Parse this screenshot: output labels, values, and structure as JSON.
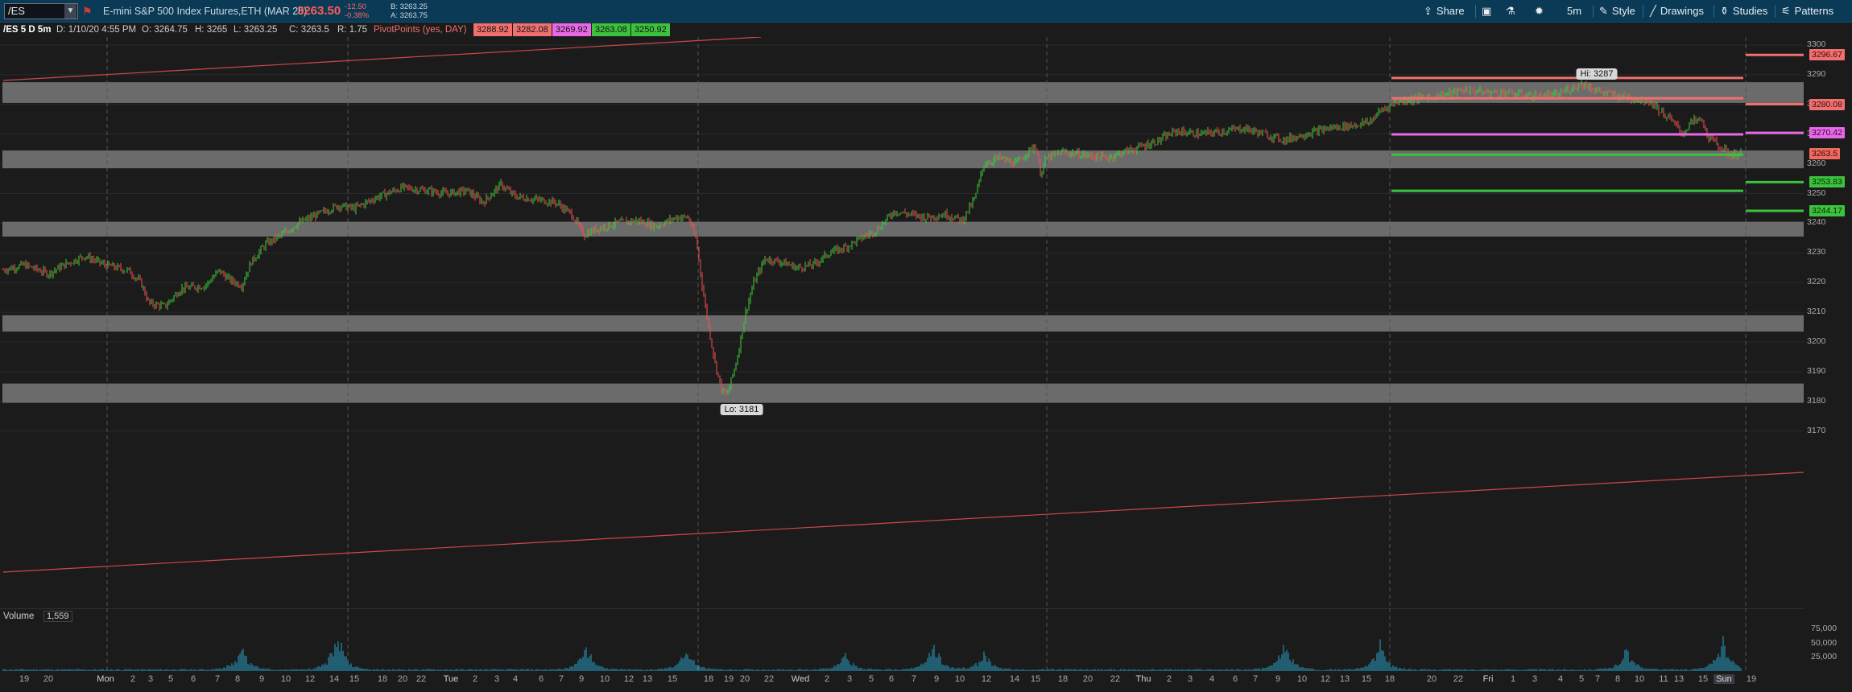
{
  "toolbar": {
    "symbol": "/ES",
    "description": "E-mini S&P 500 Index Futures,ETH (MAR 20)",
    "last_price": "3263.50",
    "change": "-12.50",
    "change_pct": "-0.38%",
    "bid": "B: 3263.25",
    "ask": "A: 3263.75",
    "share_label": "Share",
    "interval_label": "5m",
    "style_label": "Style",
    "drawings_label": "Drawings",
    "studies_label": "Studies",
    "patterns_label": "Patterns"
  },
  "info": {
    "chart_id": "/ES 5 D 5m",
    "date": "D: 1/10/20 4:55 PM",
    "open": "O: 3264.75",
    "high": "H: 3265",
    "low": "L: 3263.25",
    "close": "C: 3263.5",
    "range": "R: 1.75",
    "study": "PivotPoints (yes, DAY)",
    "r2": "3288.92",
    "r1": "3282.08",
    "pp": "3269.92",
    "s1": "3263.08",
    "s2": "3250.92"
  },
  "axis": {
    "price_ticks": [
      "3300",
      "3290",
      "3280",
      "3270",
      "3260",
      "3250",
      "3240",
      "3230",
      "3220",
      "3210",
      "3200",
      "3190",
      "3180",
      "3170"
    ],
    "price_tags": [
      {
        "label": "3296.67",
        "color": "#f07070",
        "text_color": "#3a0b0b"
      },
      {
        "label": "3280.08",
        "color": "#f07070",
        "text_color": "#3a0b0b"
      },
      {
        "label": "3270.42",
        "color": "#e868e8",
        "text_color": "#300830"
      },
      {
        "label": "3263.5",
        "color": "#f06a60",
        "text_color": "#300808"
      },
      {
        "label": "3253.83",
        "color": "#3cc23c",
        "text_color": "#062606"
      },
      {
        "label": "3244.17",
        "color": "#3cc23c",
        "text_color": "#062606"
      }
    ],
    "volume_ticks": [
      "75,000",
      "50,000",
      "25,000"
    ],
    "time_labels": [
      "19",
      "20",
      "Mon",
      "2",
      "3",
      "5",
      "6",
      "7",
      "8",
      "9",
      "10",
      "12",
      "14",
      "15",
      "18",
      "20",
      "22",
      "Tue",
      "2",
      "3",
      "4",
      "6",
      "7",
      "9",
      "10",
      "12",
      "13",
      "15",
      "18",
      "19",
      "20",
      "22",
      "Wed",
      "2",
      "3",
      "5",
      "6",
      "7",
      "9",
      "10",
      "12",
      "14",
      "15",
      "18",
      "20",
      "22",
      "Thu",
      "2",
      "3",
      "4",
      "6",
      "7",
      "9",
      "10",
      "12",
      "13",
      "15",
      "18",
      "20",
      "22",
      "Fri",
      "1",
      "3",
      "4",
      "5",
      "7",
      "8",
      "10",
      "11",
      "13",
      "15",
      "Sun",
      "19"
    ]
  },
  "annotations": {
    "high": "Hi: 3287",
    "low": "Lo: 3181"
  },
  "volume": {
    "label": "Volume",
    "value": "1,559"
  },
  "colors": {
    "up": "#3cd03c",
    "down": "#f05050",
    "zone": "#6b6b6b",
    "resistance": "#f07070",
    "pivot": "#e868e8",
    "support": "#3cc23c",
    "volume": "#2aa0c8",
    "trendline": "#d04848"
  },
  "zones_price": [
    [
      3280.5,
      3287.5
    ],
    [
      3258.5,
      3264.5
    ],
    [
      3235.5,
      3240.5
    ],
    [
      3203.5,
      3209.0
    ],
    [
      3179.5,
      3186.0
    ]
  ],
  "pivots_price": [
    {
      "price": 3288.92,
      "kind": "resistance"
    },
    {
      "price": 3282.08,
      "kind": "resistance"
    },
    {
      "price": 3269.92,
      "kind": "pivot"
    },
    {
      "price": 3263.08,
      "kind": "support"
    },
    {
      "price": 3250.92,
      "kind": "support"
    }
  ],
  "right_pivots_price": [
    3296.67,
    3280.08,
    3270.42,
    3253.83,
    3244.17
  ]
}
